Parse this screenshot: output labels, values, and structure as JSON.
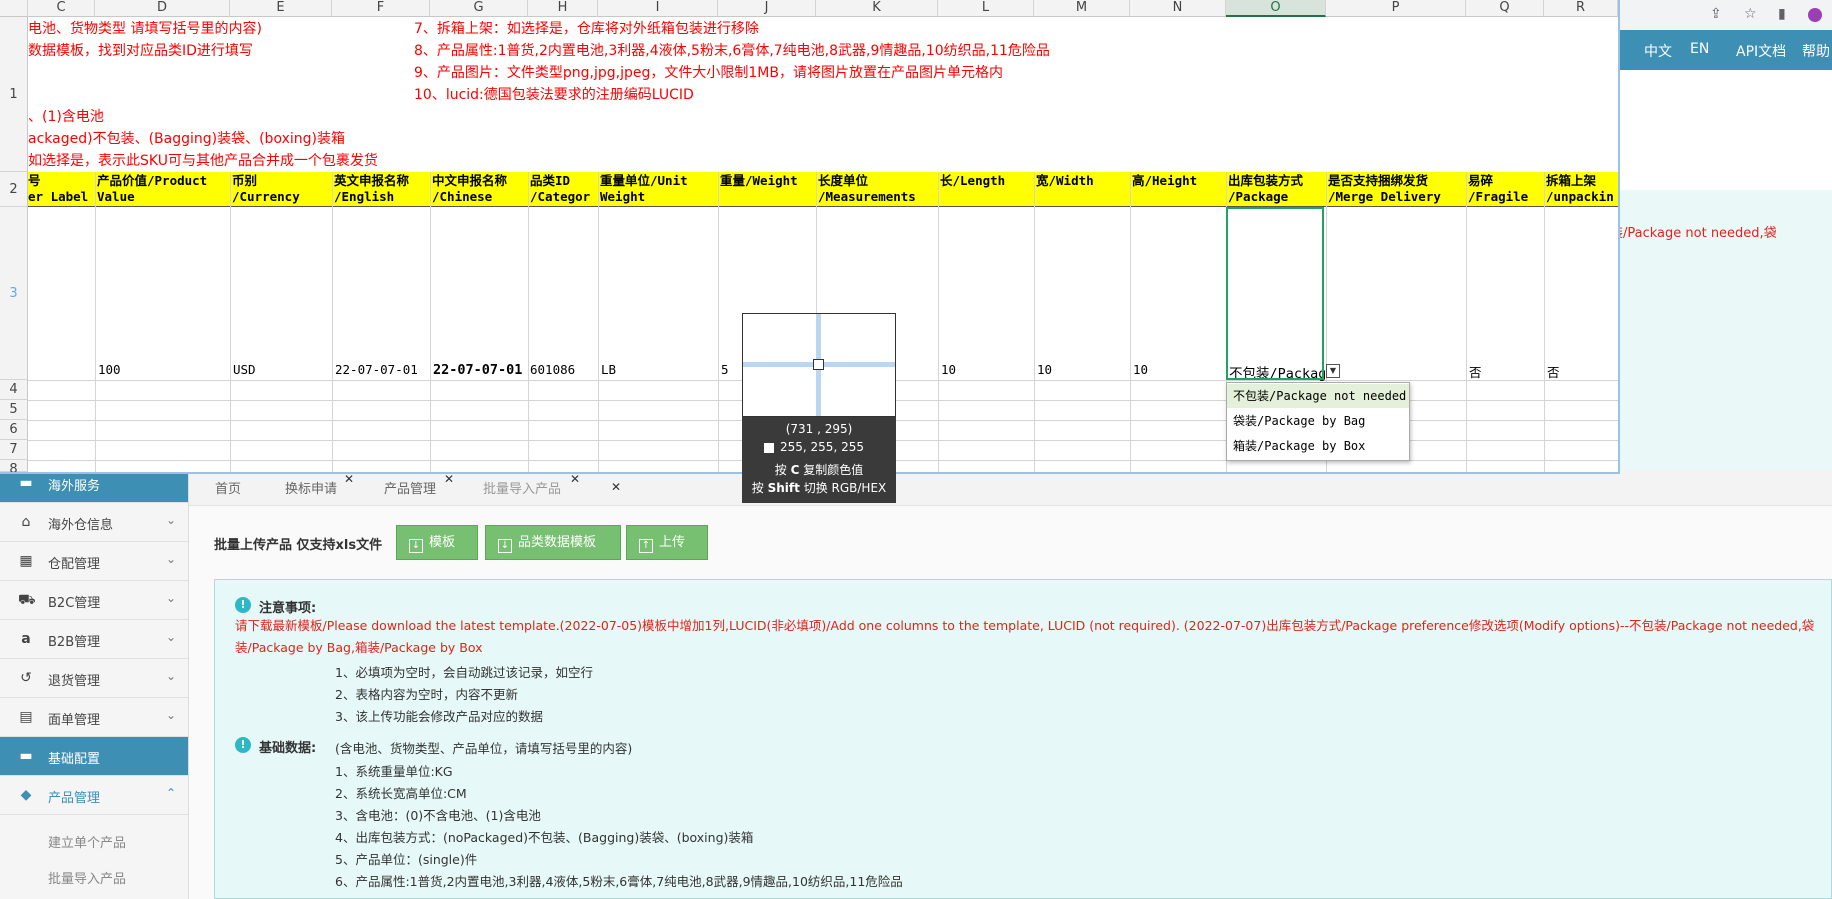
{
  "browser": {
    "icons": [
      "share-icon",
      "star-icon",
      "sidebar-icon",
      "profile-icon"
    ]
  },
  "nav": {
    "items": [
      "中文",
      "EN",
      "API文档",
      "帮助"
    ]
  },
  "sidebar": {
    "items": [
      {
        "label": "海外服务",
        "icon": "folder-icon",
        "style": "dark"
      },
      {
        "label": "海外仓信息",
        "icon": "home-icon"
      },
      {
        "label": "仓配管理",
        "icon": "grid-icon"
      },
      {
        "label": "B2C管理",
        "icon": "cart-icon"
      },
      {
        "label": "B2B管理",
        "icon": "amazon-icon"
      },
      {
        "label": "退货管理",
        "icon": "return-icon"
      },
      {
        "label": "面单管理",
        "icon": "document-icon"
      },
      {
        "label": "基础配置",
        "icon": "folder-icon",
        "style": "dark"
      },
      {
        "label": "产品管理",
        "icon": "tag-icon",
        "style": "open"
      }
    ],
    "subitems": [
      "建立单个产品",
      "批量导入产品"
    ]
  },
  "tabs": [
    {
      "label": "首页"
    },
    {
      "label": "换标申请"
    },
    {
      "label": "产品管理"
    },
    {
      "label": "批量导入产品"
    }
  ],
  "upload": {
    "label": "批量上传产品 仅支持xls文件",
    "buttons": [
      "模板",
      "品类数据模板",
      "上传"
    ]
  },
  "notice": {
    "title": "注意事项:",
    "red_text": "请下载最新模板/Please download the latest template.(2022-07-05)模板中增加1列,LUCID(非必填项)/Add one columns to the template, LUCID (not required). (2022-07-07)出库包装方式/Package preference修改选项(Modify options)--不包装/Package not needed,袋装/Package by Bag,箱装/Package by Box",
    "side_red": "装/Package not needed,袋",
    "lines": [
      "1、必填项为空时，会自动跳过该记录，如空行",
      "2、表格内容为空时，内容不更新",
      "3、该上传功能会修改产品对应的数据"
    ],
    "basic_title": "基础数据:",
    "basic_intro": "(含电池、货物类型、产品单位，请填写括号里的内容)",
    "basic_lines": [
      "1、系统重量单位:KG",
      "2、系统长宽高单位:CM",
      "3、含电池：(0)不含电池、(1)含电池",
      "4、出库包装方式：(noPackaged)不包装、(Bagging)装袋、(boxing)装箱",
      "5、产品单位：(single)件",
      "6、产品属性:1普货,2内置电池,3利器,4液体,5粉末,6膏体,7纯电池,8武器,9情趣品,10纺织品,11危险品"
    ]
  },
  "sheet": {
    "columns": [
      "C",
      "D",
      "E",
      "F",
      "G",
      "H",
      "I",
      "J",
      "K",
      "L",
      "M",
      "N",
      "O",
      "P",
      "Q",
      "R"
    ],
    "rows": [
      "1",
      "2",
      "3",
      "4",
      "5",
      "6",
      "7",
      "8"
    ],
    "notes_left": [
      "电池、货物类型 请填写括号里的内容)",
      "数据模板，找到对应品类ID进行填写",
      "、(1)含电池",
      "ackaged)不包装、(Bagging)装袋、(boxing)装箱",
      "如选择是，表示此SKU可与其他产品合并成一个包裹发货"
    ],
    "notes_right": [
      "7、拆箱上架：如选择是，仓库将对外纸箱包装进行移除",
      "8、产品属性:1普货,2内置电池,3利器,4液体,5粉末,6膏体,7纯电池,8武器,9情趣品,10纺织品,11危险品",
      "9、产品图片：文件类型png,jpg,jpeg，文件大小限制1MB，请将图片放置在产品图片单元格内",
      "10、lucid:德国包装法要求的注册编码LUCID"
    ],
    "headers": [
      {
        "l1": "号",
        "l2": "er Label"
      },
      {
        "l1": "产品价值/Product",
        "l2": "Value"
      },
      {
        "l1": "币别",
        "l2": "/Currency"
      },
      {
        "l1": "英文申报名称",
        "l2": "/English"
      },
      {
        "l1": "中文申报名称",
        "l2": "/Chinese"
      },
      {
        "l1": "品类ID",
        "l2": "/Categor"
      },
      {
        "l1": "重量单位/Unit",
        "l2": "Weight"
      },
      {
        "l1": "重量/Weight",
        "l2": ""
      },
      {
        "l1": "长度单位",
        "l2": "/Measurements"
      },
      {
        "l1": "长/Length",
        "l2": ""
      },
      {
        "l1": "宽/Width",
        "l2": ""
      },
      {
        "l1": "高/Height",
        "l2": ""
      },
      {
        "l1": "出库包装方式",
        "l2": "/Package"
      },
      {
        "l1": "是否支持捆绑发货",
        "l2": "/Merge Delivery"
      },
      {
        "l1": "易碎",
        "l2": "/Fragile"
      },
      {
        "l1": "拆箱上架",
        "l2": "/unpackin"
      }
    ],
    "row3": [
      "",
      "100",
      "USD",
      "22-07-07-01",
      "22-07-07-01",
      "601086",
      "LB",
      "5",
      "",
      "10",
      "10",
      "10",
      "不包装/Package",
      "",
      "否",
      "否"
    ],
    "dropdown": [
      "不包装/Package not needed",
      "袋装/Package by Bag",
      "箱装/Package by Box"
    ]
  },
  "picker": {
    "coords": "(731 , 295)",
    "rgb": "255, 255, 255",
    "copy_pre": "按",
    "copy_key": "C",
    "copy_post": "复制颜色值",
    "shift_pre": "按",
    "shift_key": "Shift",
    "shift_post": "切换 RGB/HEX"
  },
  "colors": {
    "accent": "#3d8fb3",
    "green_button": "#78c071",
    "header_yellow": "#ffff00",
    "note_red": "#ff0000",
    "selection_green": "#21a366"
  }
}
